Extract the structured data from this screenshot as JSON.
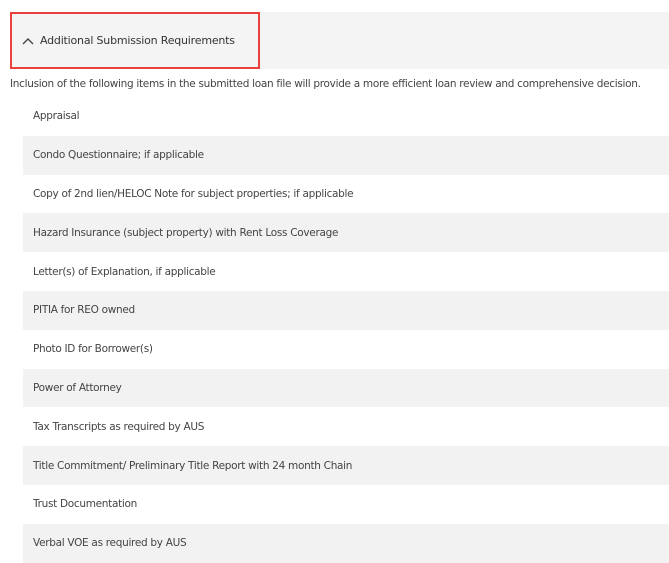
{
  "section": {
    "title": "Additional Submission Requirements",
    "intro": "Inclusion of the following items in the submitted loan file will provide a more efficient loan review and comprehensive decision.",
    "toggle_icon": "chevron-up-icon",
    "highlight_color": "#e8403d",
    "items": [
      {
        "label": "Appraisal"
      },
      {
        "label": "Condo Questionnaire; if applicable"
      },
      {
        "label": "Copy of 2nd lien/HELOC Note for subject properties; if applicable"
      },
      {
        "label": "Hazard Insurance (subject property) with Rent Loss Coverage"
      },
      {
        "label": "Letter(s) of Explanation, if applicable"
      },
      {
        "label": "PITIA for REO owned"
      },
      {
        "label": "Photo ID for Borrower(s)"
      },
      {
        "label": "Power of Attorney"
      },
      {
        "label": "Tax Transcripts as required by AUS"
      },
      {
        "label": "Title Commitment/ Preliminary Title Report with 24 month Chain"
      },
      {
        "label": "Trust Documentation"
      },
      {
        "label": "Verbal VOE as required by AUS"
      }
    ]
  }
}
